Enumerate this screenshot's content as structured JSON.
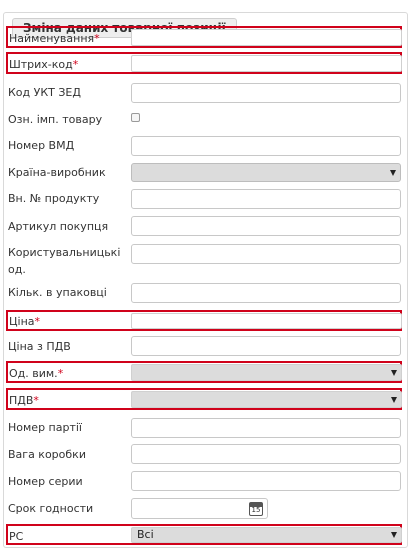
{
  "form": {
    "title": "Зміна даних товарної позиції",
    "fields": {
      "name": {
        "label": "Найменування",
        "required_mark": "*",
        "value": ""
      },
      "barcode": {
        "label": "Штрих-код",
        "required_mark": "*",
        "value": ""
      },
      "uktzed": {
        "label": "Код УКТ ЗЕД",
        "value": ""
      },
      "import_flag": {
        "label": "Озн. імп. товару",
        "checked": false
      },
      "vmd": {
        "label": "Номер ВМД",
        "value": ""
      },
      "country": {
        "label": "Країна-виробник",
        "selected": ""
      },
      "internal_no": {
        "label": "Вн. № продукту",
        "value": ""
      },
      "buyer_article": {
        "label": "Артикул покупця",
        "value": ""
      },
      "user_units": {
        "label_line1": "Користувальницькі",
        "label_line2": "од.",
        "value": ""
      },
      "pack_qty": {
        "label": "Кільк. в упаковці",
        "value": ""
      },
      "price": {
        "label": "Ціна",
        "required_mark": "*",
        "value": ""
      },
      "price_vat": {
        "label": "Ціна з ПДВ",
        "value": ""
      },
      "unit": {
        "label": "Од. вим.",
        "required_mark": "*",
        "selected": ""
      },
      "vat": {
        "label": "ПДВ",
        "required_mark": "*",
        "selected": ""
      },
      "batch_no": {
        "label": "Номер партії",
        "value": ""
      },
      "box_weight": {
        "label": "Вага коробки",
        "value": ""
      },
      "serial_no": {
        "label": "Номер серии",
        "value": ""
      },
      "expiry": {
        "label": "Срок годности",
        "value": "",
        "calendar_icon_text": "15"
      },
      "rs": {
        "label": "РС",
        "selected": "Всі"
      }
    }
  },
  "colors": {
    "required_border": "#d0021b",
    "select_bg": "#dcdcdc"
  }
}
